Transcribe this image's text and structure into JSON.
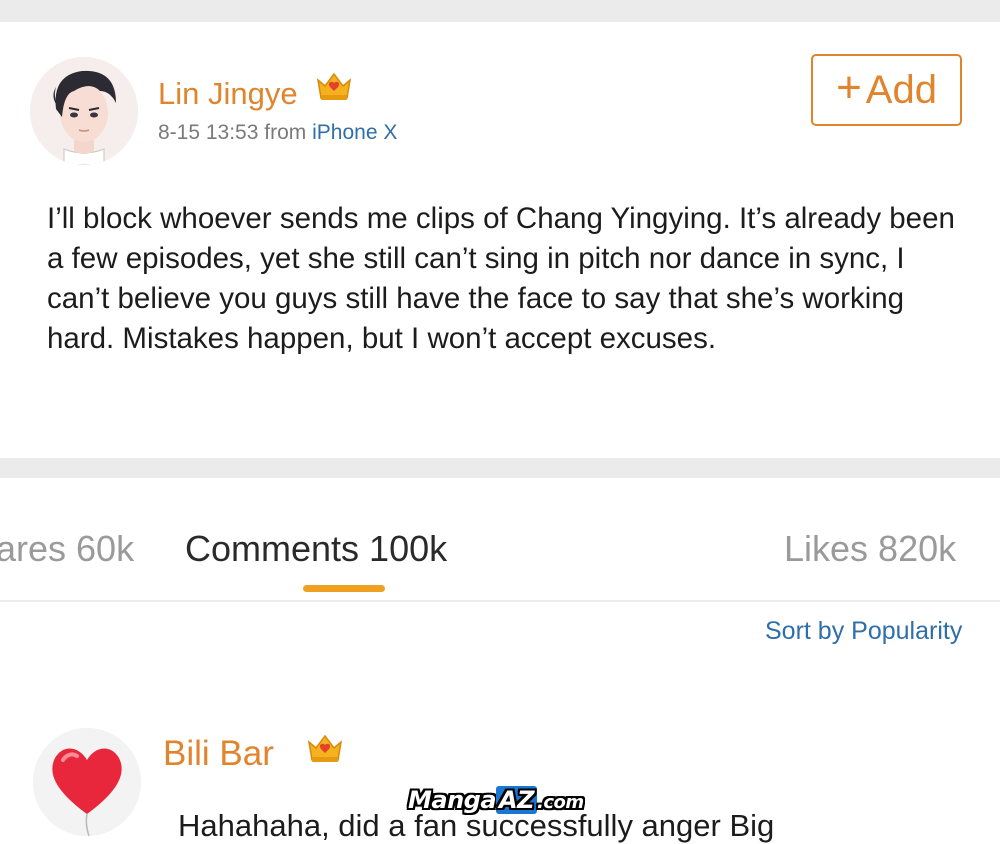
{
  "post": {
    "author_name": "Lin Jingye",
    "timestamp": "8-15 13:53",
    "from_label": "from",
    "device": "iPhone X",
    "add_plus": "+",
    "add_label": "Add",
    "body": "I’ll block whoever sends me clips of Chang Yingying. It’s already been a few episodes, yet she still can’t sing in pitch nor dance in sync, I can’t believe you guys still have the face to say that she’s working hard. Mistakes happen, but I won’t accept excuses."
  },
  "tabs": {
    "shares": "ares 60k",
    "comments": "Comments 100k",
    "likes": "Likes 820k"
  },
  "sort_label": "Sort by Popularity",
  "comment": {
    "author_name": "Bili Bar",
    "text": "Hahahaha, did a fan successfully anger Big"
  },
  "watermark": {
    "part1": "Manga",
    "part2": "AZ",
    "part3": ".com"
  },
  "colors": {
    "accent": "#e0842e",
    "link": "#2f6ea8",
    "tab_indicator": "#f0a020",
    "separator": "#ebebeb"
  },
  "icons": {
    "badge": "crown-icon",
    "commenter_avatar": "heart-balloon-icon"
  }
}
